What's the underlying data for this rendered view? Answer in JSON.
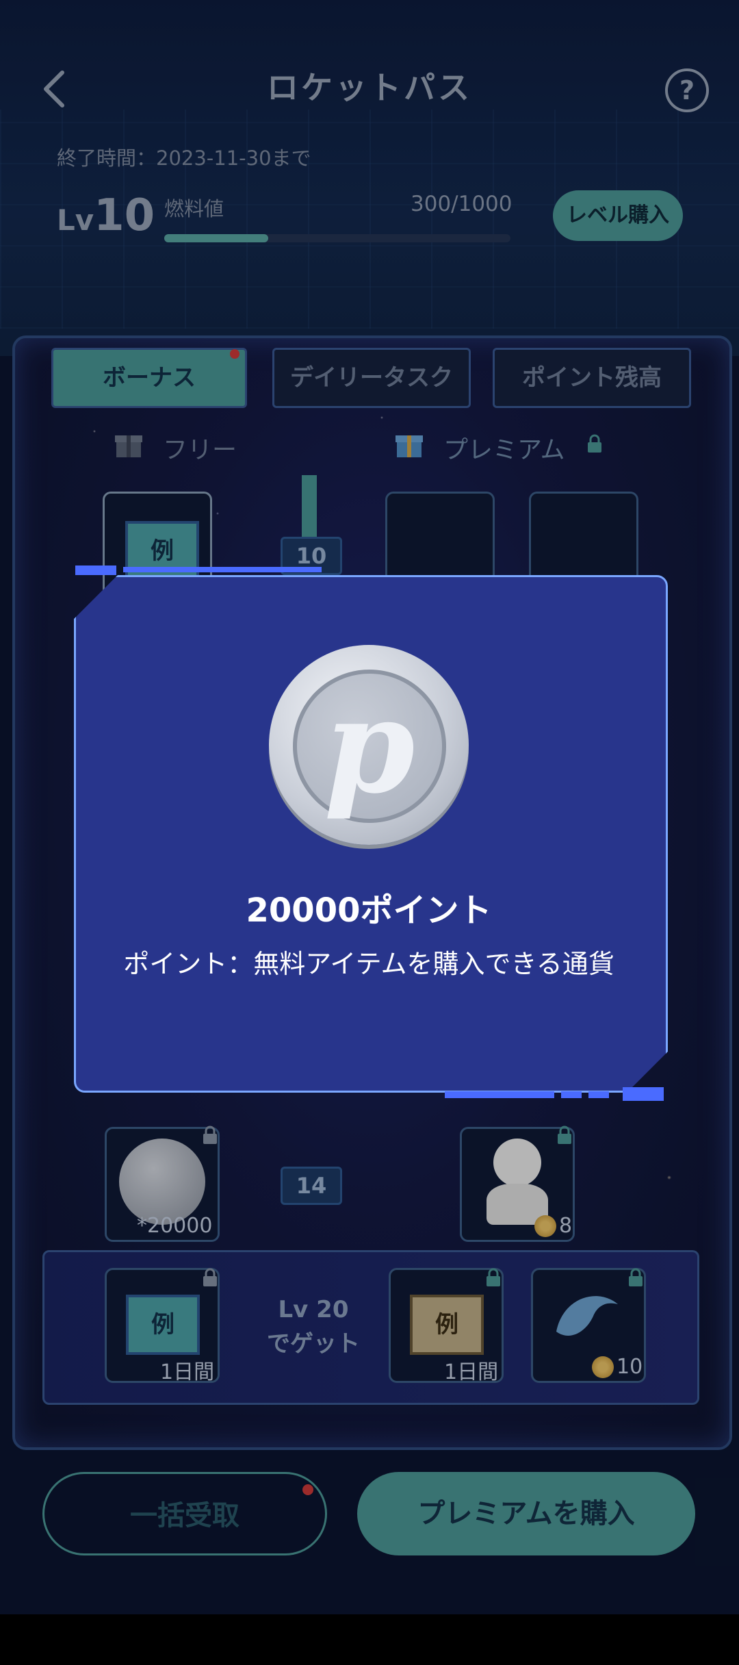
{
  "header": {
    "title": "ロケットパス",
    "end_time": "終了時間：2023-11-30まで",
    "level_prefix": "Lv",
    "level": "10",
    "fuel_label": "燃料値",
    "fuel_value": "300/1000",
    "fuel_progress": 0.3,
    "buy_level_label": "レベル購入"
  },
  "tabs": [
    {
      "label": "ボーナス",
      "active": true
    },
    {
      "label": "デイリータスク",
      "active": false
    },
    {
      "label": "ポイント残高",
      "active": false
    }
  ],
  "columns": {
    "free": "フリー",
    "premium": "プレミアム"
  },
  "track": {
    "row_top": {
      "level": "10",
      "free_tag": "例"
    },
    "row_bottom": {
      "level": "14",
      "free_qty": "*20000",
      "premium_qty": "8"
    }
  },
  "highlight_row": {
    "free_tag": "例",
    "free_duration": "1日間",
    "level_text_line1": "Lv 20",
    "level_text_line2": "でゲット",
    "premium_tag": "例",
    "premium_duration": "1日間",
    "premium_qty": "10"
  },
  "footer": {
    "claim_all": "一括受取",
    "buy_premium": "プレミアムを購入"
  },
  "modal": {
    "coin_letter": "p",
    "title": "20000ポイント",
    "description": "ポイント：無料アイテムを購入できる通貨"
  },
  "colors": {
    "accent": "#4c9a98",
    "modal_bg": "#28358c",
    "modal_border": "#7aa7ff",
    "notify_dot": "#d13a3a"
  }
}
